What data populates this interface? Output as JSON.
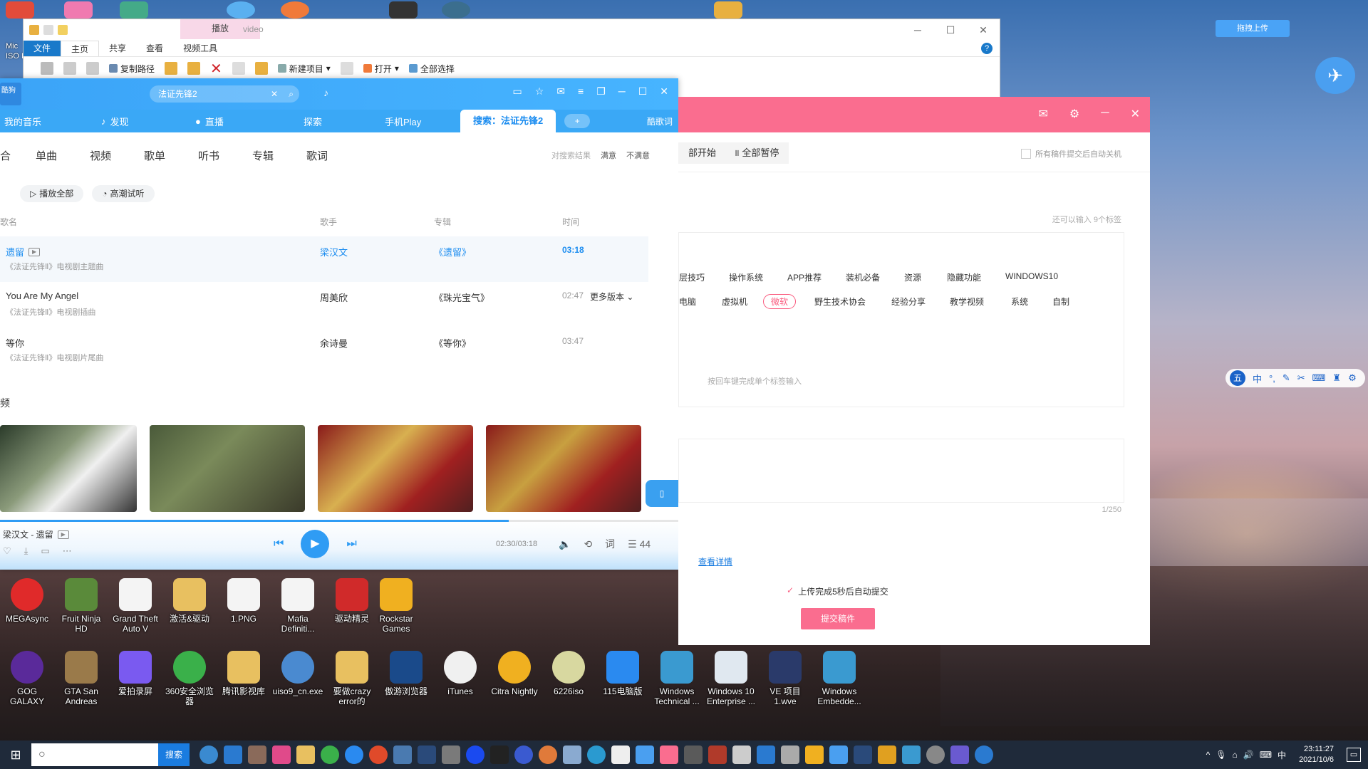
{
  "top_desktop": {
    "mic_label": "Mic\nISO D"
  },
  "explorer": {
    "context_tab": "播放",
    "title": "video",
    "tabs": [
      "文件",
      "主页",
      "共享",
      "查看",
      "视频工具"
    ],
    "ribbon": {
      "copy_path": "复制路径",
      "new_item": "新建项目",
      "open": "打开",
      "select_all": "全部选择"
    }
  },
  "player": {
    "logo_text": "酷狗",
    "search_value": "法证先锋2",
    "nav": [
      "我的音乐",
      "发现",
      "直播",
      "探索",
      "手机Play"
    ],
    "nav_active": "搜索：法证先锋2",
    "lyrics_btn": "酷歌词",
    "filters": [
      "单曲",
      "视频",
      "歌单",
      "听书",
      "专辑",
      "歌词"
    ],
    "feedback": {
      "q": "对搜索结果",
      "good": "满意",
      "bad": "不满意"
    },
    "btn_play_all": "播放全部",
    "btn_hq": "高潮试听",
    "th": {
      "song": "歌名",
      "artist": "歌手",
      "album": "专辑",
      "time": "时间"
    },
    "rows": [
      {
        "song": "遗留",
        "sub": "《法证先锋Ⅱ》电视剧主题曲",
        "artist": "梁汉文",
        "album": "《遗留》",
        "time": "03:18",
        "more": ""
      },
      {
        "song": "You Are My Angel",
        "sub": "《法证先锋Ⅱ》电视剧插曲",
        "artist": "周美欣",
        "album": "《珠光宝气》",
        "time": "02:47",
        "more": "更多版本"
      },
      {
        "song": "等你",
        "sub": "《法证先锋Ⅱ》电视剧片尾曲",
        "artist": "余诗曼",
        "album": "《等你》",
        "time": "03:47",
        "more": ""
      }
    ],
    "videos_label": "频",
    "now_playing": "梁汉文 - 遗留",
    "time": "02:30/03:18",
    "queue_count": "44",
    "progress": 0.75
  },
  "upload": {
    "btn_start": "部开始",
    "btn_pause": "全部暂停",
    "auto_shutdown": "所有稿件提交后自动关机",
    "hint_tags": "还可以输入 9个标签",
    "tags_row1": [
      "层技巧",
      "操作系统",
      "APP推荐",
      "装机必备",
      "资源",
      "隐藏功能",
      "WINDOWS10"
    ],
    "tags_row2": [
      "电脑",
      "虚拟机",
      "微软",
      "野生技术协会",
      "经验分享",
      "教学视频",
      "系统",
      "自制"
    ],
    "tag_input_hint": "按回车键完成单个标签输入",
    "char_count": "1/250",
    "detail_link": "查看详情",
    "auto_submit": "上传完成5秒后自动提交",
    "submit": "提交稿件"
  },
  "floaters": {
    "baidu": "拖拽上传",
    "ime": [
      "中",
      "°,"
    ]
  },
  "desktop_icons_row1": [
    "MEGAsync",
    "Fruit Ninja HD",
    "Grand Theft Auto V",
    "激活&驱动",
    "1.PNG",
    "Mafia Definiti...",
    "驱动精灵",
    "Rockstar Games"
  ],
  "desktop_icons_row2": [
    "GOG GALAXY",
    "GTA San Andreas",
    "爱拍录屏",
    "360安全浏览器",
    "腾讯影视库",
    "uiso9_cn.exe",
    "要做crazy error的",
    "傲游浏览器",
    "iTunes",
    "Citra Nightly",
    "6226iso",
    "115电脑版",
    "Windows Technical ...",
    "Windows 10 Enterprise ...",
    "VE 项目 1.wve",
    "Windows Embedde..."
  ],
  "taskbar": {
    "search_btn": "搜索",
    "time": "23:11:27",
    "date": "2021/10/6",
    "lang": "中"
  }
}
